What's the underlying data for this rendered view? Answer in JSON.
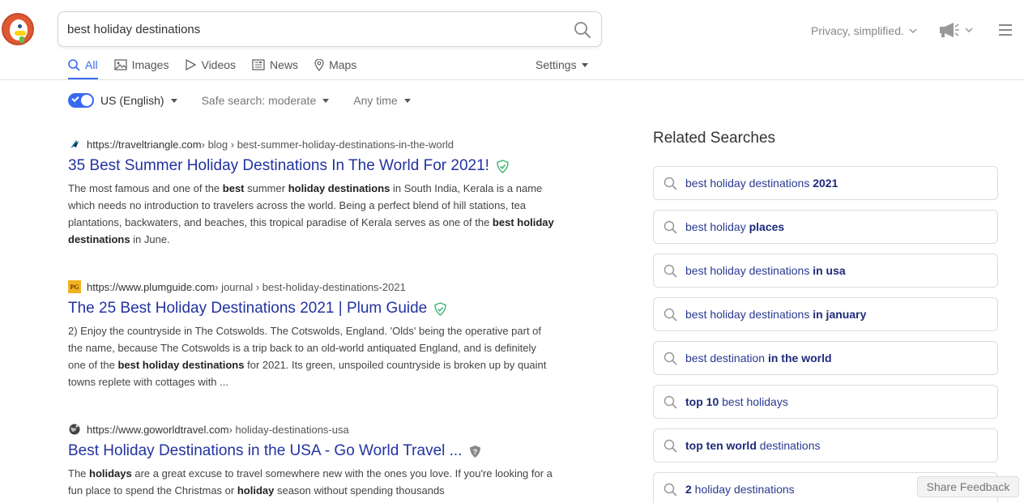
{
  "search": {
    "query": "best holiday destinations"
  },
  "header": {
    "privacy_label": "Privacy, simplified."
  },
  "tabs": [
    {
      "label": "All"
    },
    {
      "label": "Images"
    },
    {
      "label": "Videos"
    },
    {
      "label": "News"
    },
    {
      "label": "Maps"
    }
  ],
  "settings_label": "Settings",
  "filters": {
    "region": "US (English)",
    "safe_search": "Safe search: moderate",
    "time": "Any time"
  },
  "results": [
    {
      "domain": "https://traveltriangle.com",
      "path": " › blog › best-summer-holiday-destinations-in-the-world",
      "title": "35 Best Summer Holiday Destinations In The World For 2021!",
      "snippet_html": "The most famous and one of the <b>best</b> summer <b>holiday destinations</b> in South India, Kerala is a name which needs no introduction to travelers across the world. Being a perfect blend of hill stations, tea plantations, backwaters, and beaches, this tropical paradise of Kerala serves as one of the <b>best holiday destinations</b> in June."
    },
    {
      "domain": "https://www.plumguide.com",
      "path": " › journal › best-holiday-destinations-2021",
      "title": "The 25 Best Holiday Destinations 2021 | Plum Guide",
      "favicon_text": "PG",
      "snippet_html": "2) Enjoy the countryside in The Cotswolds. The Cotswolds, England. 'Olds' being the operative part of the name, because The Cotswolds is a trip back to an old-world antiquated England, and is definitely one of the <b>best holiday destinations</b> for 2021. Its green, unspoiled countryside is broken up by quaint towns replete with cottages with ..."
    },
    {
      "domain": "https://www.goworldtravel.com",
      "path": " › holiday-destinations-usa",
      "title": "Best Holiday Destinations in the USA - Go World Travel ...",
      "snippet_html": "The <b>holidays</b> are a great excuse to travel somewhere new with the ones you love. If you're looking for a fun place to spend the Christmas or <b>holiday</b> season without spending thousands"
    }
  ],
  "related": {
    "heading": "Related Searches",
    "items": [
      {
        "plain": "best holiday destinations ",
        "bold": "2021"
      },
      {
        "plain": "best holiday ",
        "bold": "places"
      },
      {
        "plain": "best holiday destinations ",
        "bold": "in usa"
      },
      {
        "plain": "best holiday destinations ",
        "bold": "in january"
      },
      {
        "plain": "best destination ",
        "bold": "in the world"
      },
      {
        "bold_first": "top 10",
        "plain": " best holidays"
      },
      {
        "bold_first": "top ten world",
        "plain": " destinations"
      },
      {
        "bold_first": "2",
        "plain": " holiday destinations"
      }
    ]
  },
  "feedback_label": "Share Feedback",
  "colors": {
    "accent": "#3969ef",
    "link": "#2233a0",
    "brand": "#de5833"
  }
}
